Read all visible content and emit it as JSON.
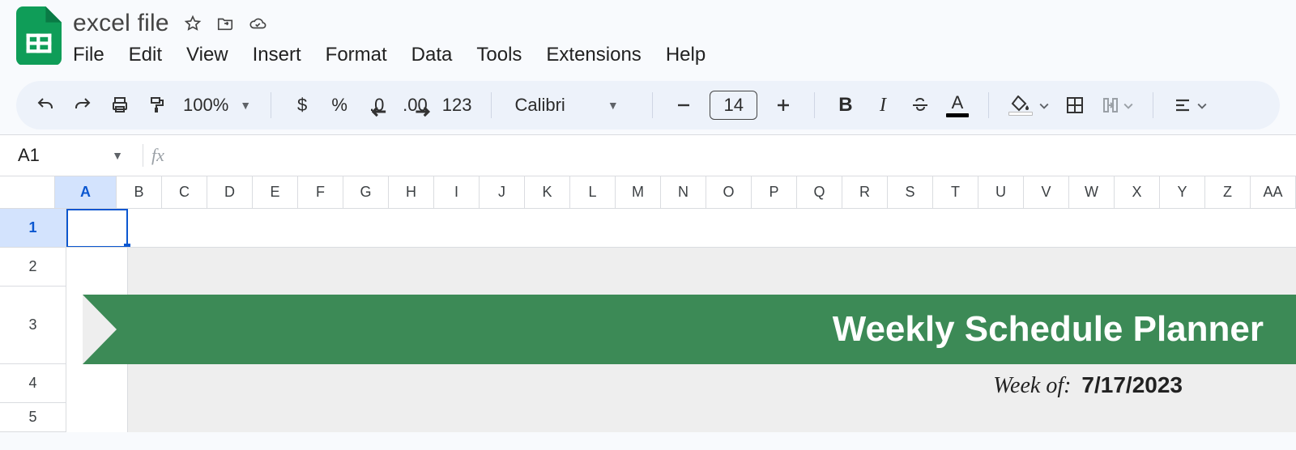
{
  "doc": {
    "title": "excel file"
  },
  "menus": {
    "file": "File",
    "edit": "Edit",
    "view": "View",
    "insert": "Insert",
    "format": "Format",
    "data": "Data",
    "tools": "Tools",
    "extensions": "Extensions",
    "help": "Help"
  },
  "toolbar": {
    "zoom": "100%",
    "currency": "$",
    "percent": "%",
    "dec_less": ".0",
    "dec_more": ".00",
    "num_fmt": "123",
    "font_name": "Calibri",
    "font_size": "14",
    "text_color_letter": "A"
  },
  "name_box": "A1",
  "columns": [
    "A",
    "B",
    "C",
    "D",
    "E",
    "F",
    "G",
    "H",
    "I",
    "J",
    "K",
    "L",
    "M",
    "N",
    "O",
    "P",
    "Q",
    "R",
    "S",
    "T",
    "U",
    "V",
    "W",
    "X",
    "Y",
    "Z",
    "AA"
  ],
  "rows": [
    "1",
    "2",
    "3",
    "4",
    "5"
  ],
  "active": {
    "col": "A",
    "row": "1"
  },
  "content": {
    "banner_title": "Weekly Schedule Planner",
    "weekof_label": "Week of:",
    "weekof_date": "7/17/2023"
  }
}
